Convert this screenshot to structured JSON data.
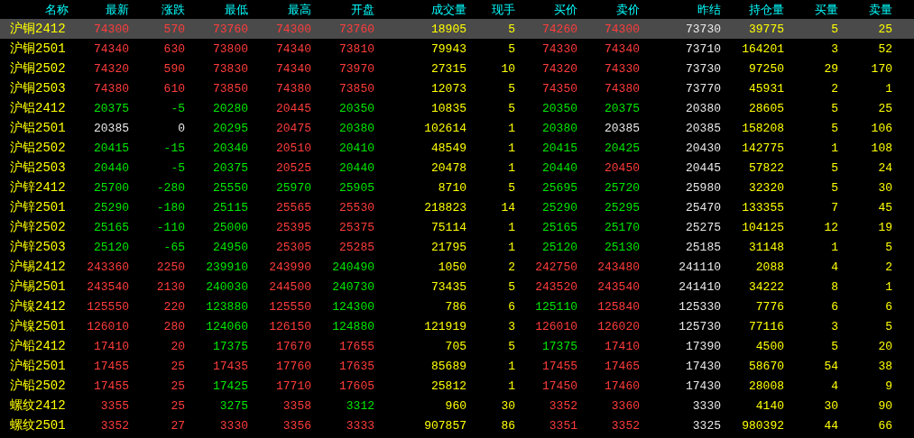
{
  "table": {
    "columns": [
      {
        "label": "名称",
        "kind": "name"
      },
      {
        "label": "最新",
        "kind": "price"
      },
      {
        "label": "涨跌",
        "kind": "price"
      },
      {
        "label": "最低",
        "kind": "price"
      },
      {
        "label": "最高",
        "kind": "price"
      },
      {
        "label": "开盘",
        "kind": "price"
      },
      {
        "label": "成交量",
        "kind": "volume"
      },
      {
        "label": "现手",
        "kind": "volume"
      },
      {
        "label": "买价",
        "kind": "price"
      },
      {
        "label": "卖价",
        "kind": "price"
      },
      {
        "label": "昨结",
        "kind": "ref"
      },
      {
        "label": "持仓量",
        "kind": "volume"
      },
      {
        "label": "买量",
        "kind": "volume"
      },
      {
        "label": "卖量",
        "kind": "volume"
      }
    ],
    "rows": [
      {
        "selected": true,
        "cells": [
          {
            "text": "沪铜2412"
          },
          {
            "text": "74300",
            "color": "#ff3c3c"
          },
          {
            "text": "570",
            "color": "#ff3c3c"
          },
          {
            "text": "73760",
            "color": "#ff3c3c"
          },
          {
            "text": "74300",
            "color": "#ff3c3c"
          },
          {
            "text": "73760",
            "color": "#ff3c3c"
          },
          {
            "text": "18905"
          },
          {
            "text": "5"
          },
          {
            "text": "74260",
            "color": "#ff3c3c"
          },
          {
            "text": "74300",
            "color": "#ff3c3c"
          },
          {
            "text": "73730"
          },
          {
            "text": "39775"
          },
          {
            "text": "5"
          },
          {
            "text": "25"
          }
        ]
      },
      {
        "selected": false,
        "cells": [
          {
            "text": "沪铜2501"
          },
          {
            "text": "74340",
            "color": "#ff3c3c"
          },
          {
            "text": "630",
            "color": "#ff3c3c"
          },
          {
            "text": "73800",
            "color": "#ff3c3c"
          },
          {
            "text": "74340",
            "color": "#ff3c3c"
          },
          {
            "text": "73810",
            "color": "#ff3c3c"
          },
          {
            "text": "79943"
          },
          {
            "text": "5"
          },
          {
            "text": "74330",
            "color": "#ff3c3c"
          },
          {
            "text": "74340",
            "color": "#ff3c3c"
          },
          {
            "text": "73710"
          },
          {
            "text": "164201"
          },
          {
            "text": "3"
          },
          {
            "text": "52"
          }
        ]
      },
      {
        "selected": false,
        "cells": [
          {
            "text": "沪铜2502"
          },
          {
            "text": "74320",
            "color": "#ff3c3c"
          },
          {
            "text": "590",
            "color": "#ff3c3c"
          },
          {
            "text": "73830",
            "color": "#ff3c3c"
          },
          {
            "text": "74340",
            "color": "#ff3c3c"
          },
          {
            "text": "73970",
            "color": "#ff3c3c"
          },
          {
            "text": "27315"
          },
          {
            "text": "10"
          },
          {
            "text": "74320",
            "color": "#ff3c3c"
          },
          {
            "text": "74330",
            "color": "#ff3c3c"
          },
          {
            "text": "73730"
          },
          {
            "text": "97250"
          },
          {
            "text": "29"
          },
          {
            "text": "170"
          }
        ]
      },
      {
        "selected": false,
        "cells": [
          {
            "text": "沪铜2503"
          },
          {
            "text": "74380",
            "color": "#ff3c3c"
          },
          {
            "text": "610",
            "color": "#ff3c3c"
          },
          {
            "text": "73850",
            "color": "#ff3c3c"
          },
          {
            "text": "74380",
            "color": "#ff3c3c"
          },
          {
            "text": "73850",
            "color": "#ff3c3c"
          },
          {
            "text": "12073"
          },
          {
            "text": "5"
          },
          {
            "text": "74350",
            "color": "#ff3c3c"
          },
          {
            "text": "74380",
            "color": "#ff3c3c"
          },
          {
            "text": "73770"
          },
          {
            "text": "45931"
          },
          {
            "text": "2"
          },
          {
            "text": "1"
          }
        ]
      },
      {
        "selected": false,
        "cells": [
          {
            "text": "沪铝2412"
          },
          {
            "text": "20375",
            "color": "#00e800"
          },
          {
            "text": "-5",
            "color": "#00e800"
          },
          {
            "text": "20280",
            "color": "#00e800"
          },
          {
            "text": "20445",
            "color": "#ff3c3c"
          },
          {
            "text": "20350",
            "color": "#00e800"
          },
          {
            "text": "10835"
          },
          {
            "text": "5"
          },
          {
            "text": "20350",
            "color": "#00e800"
          },
          {
            "text": "20375",
            "color": "#00e800"
          },
          {
            "text": "20380"
          },
          {
            "text": "28605"
          },
          {
            "text": "5"
          },
          {
            "text": "25"
          }
        ]
      },
      {
        "selected": false,
        "cells": [
          {
            "text": "沪铝2501"
          },
          {
            "text": "20385",
            "color": "#e8e8e8"
          },
          {
            "text": "0",
            "color": "#e8e8e8"
          },
          {
            "text": "20295",
            "color": "#00e800"
          },
          {
            "text": "20475",
            "color": "#ff3c3c"
          },
          {
            "text": "20380",
            "color": "#00e800"
          },
          {
            "text": "102614"
          },
          {
            "text": "1"
          },
          {
            "text": "20380",
            "color": "#00e800"
          },
          {
            "text": "20385",
            "color": "#e8e8e8"
          },
          {
            "text": "20385"
          },
          {
            "text": "158208"
          },
          {
            "text": "5"
          },
          {
            "text": "106"
          }
        ]
      },
      {
        "selected": false,
        "cells": [
          {
            "text": "沪铝2502"
          },
          {
            "text": "20415",
            "color": "#00e800"
          },
          {
            "text": "-15",
            "color": "#00e800"
          },
          {
            "text": "20340",
            "color": "#00e800"
          },
          {
            "text": "20510",
            "color": "#ff3c3c"
          },
          {
            "text": "20410",
            "color": "#00e800"
          },
          {
            "text": "48549"
          },
          {
            "text": "1"
          },
          {
            "text": "20415",
            "color": "#00e800"
          },
          {
            "text": "20425",
            "color": "#00e800"
          },
          {
            "text": "20430"
          },
          {
            "text": "142775"
          },
          {
            "text": "1"
          },
          {
            "text": "108"
          }
        ]
      },
      {
        "selected": false,
        "cells": [
          {
            "text": "沪铝2503"
          },
          {
            "text": "20440",
            "color": "#00e800"
          },
          {
            "text": "-5",
            "color": "#00e800"
          },
          {
            "text": "20375",
            "color": "#00e800"
          },
          {
            "text": "20525",
            "color": "#ff3c3c"
          },
          {
            "text": "20440",
            "color": "#00e800"
          },
          {
            "text": "20478"
          },
          {
            "text": "1"
          },
          {
            "text": "20440",
            "color": "#00e800"
          },
          {
            "text": "20450",
            "color": "#ff3c3c"
          },
          {
            "text": "20445"
          },
          {
            "text": "57822"
          },
          {
            "text": "5"
          },
          {
            "text": "24"
          }
        ]
      },
      {
        "selected": false,
        "cells": [
          {
            "text": "沪锌2412"
          },
          {
            "text": "25700",
            "color": "#00e800"
          },
          {
            "text": "-280",
            "color": "#00e800"
          },
          {
            "text": "25550",
            "color": "#00e800"
          },
          {
            "text": "25970",
            "color": "#00e800"
          },
          {
            "text": "25905",
            "color": "#00e800"
          },
          {
            "text": "8710"
          },
          {
            "text": "5"
          },
          {
            "text": "25695",
            "color": "#00e800"
          },
          {
            "text": "25720",
            "color": "#00e800"
          },
          {
            "text": "25980"
          },
          {
            "text": "32320"
          },
          {
            "text": "5"
          },
          {
            "text": "30"
          }
        ]
      },
      {
        "selected": false,
        "cells": [
          {
            "text": "沪锌2501"
          },
          {
            "text": "25290",
            "color": "#00e800"
          },
          {
            "text": "-180",
            "color": "#00e800"
          },
          {
            "text": "25115",
            "color": "#00e800"
          },
          {
            "text": "25565",
            "color": "#ff3c3c"
          },
          {
            "text": "25530",
            "color": "#ff3c3c"
          },
          {
            "text": "218823"
          },
          {
            "text": "14"
          },
          {
            "text": "25290",
            "color": "#00e800"
          },
          {
            "text": "25295",
            "color": "#00e800"
          },
          {
            "text": "25470"
          },
          {
            "text": "133355"
          },
          {
            "text": "7"
          },
          {
            "text": "45"
          }
        ]
      },
      {
        "selected": false,
        "cells": [
          {
            "text": "沪锌2502"
          },
          {
            "text": "25165",
            "color": "#00e800"
          },
          {
            "text": "-110",
            "color": "#00e800"
          },
          {
            "text": "25000",
            "color": "#00e800"
          },
          {
            "text": "25395",
            "color": "#ff3c3c"
          },
          {
            "text": "25375",
            "color": "#ff3c3c"
          },
          {
            "text": "75114"
          },
          {
            "text": "1"
          },
          {
            "text": "25165",
            "color": "#00e800"
          },
          {
            "text": "25170",
            "color": "#00e800"
          },
          {
            "text": "25275"
          },
          {
            "text": "104125"
          },
          {
            "text": "12"
          },
          {
            "text": "19"
          }
        ]
      },
      {
        "selected": false,
        "cells": [
          {
            "text": "沪锌2503"
          },
          {
            "text": "25120",
            "color": "#00e800"
          },
          {
            "text": "-65",
            "color": "#00e800"
          },
          {
            "text": "24950",
            "color": "#00e800"
          },
          {
            "text": "25305",
            "color": "#ff3c3c"
          },
          {
            "text": "25285",
            "color": "#ff3c3c"
          },
          {
            "text": "21795"
          },
          {
            "text": "1"
          },
          {
            "text": "25120",
            "color": "#00e800"
          },
          {
            "text": "25130",
            "color": "#00e800"
          },
          {
            "text": "25185"
          },
          {
            "text": "31148"
          },
          {
            "text": "1"
          },
          {
            "text": "5"
          }
        ]
      },
      {
        "selected": false,
        "cells": [
          {
            "text": "沪锡2412"
          },
          {
            "text": "243360",
            "color": "#ff3c3c"
          },
          {
            "text": "2250",
            "color": "#ff3c3c"
          },
          {
            "text": "239910",
            "color": "#00e800"
          },
          {
            "text": "243990",
            "color": "#ff3c3c"
          },
          {
            "text": "240490",
            "color": "#00e800"
          },
          {
            "text": "1050"
          },
          {
            "text": "2"
          },
          {
            "text": "242750",
            "color": "#ff3c3c"
          },
          {
            "text": "243480",
            "color": "#ff3c3c"
          },
          {
            "text": "241110"
          },
          {
            "text": "2088"
          },
          {
            "text": "4"
          },
          {
            "text": "2"
          }
        ]
      },
      {
        "selected": false,
        "cells": [
          {
            "text": "沪锡2501"
          },
          {
            "text": "243540",
            "color": "#ff3c3c"
          },
          {
            "text": "2130",
            "color": "#ff3c3c"
          },
          {
            "text": "240030",
            "color": "#00e800"
          },
          {
            "text": "244500",
            "color": "#ff3c3c"
          },
          {
            "text": "240730",
            "color": "#00e800"
          },
          {
            "text": "73435"
          },
          {
            "text": "5"
          },
          {
            "text": "243520",
            "color": "#ff3c3c"
          },
          {
            "text": "243540",
            "color": "#ff3c3c"
          },
          {
            "text": "241410"
          },
          {
            "text": "34222"
          },
          {
            "text": "8"
          },
          {
            "text": "1"
          }
        ]
      },
      {
        "selected": false,
        "cells": [
          {
            "text": "沪镍2412"
          },
          {
            "text": "125550",
            "color": "#ff3c3c"
          },
          {
            "text": "220",
            "color": "#ff3c3c"
          },
          {
            "text": "123880",
            "color": "#00e800"
          },
          {
            "text": "125550",
            "color": "#ff3c3c"
          },
          {
            "text": "124300",
            "color": "#00e800"
          },
          {
            "text": "786"
          },
          {
            "text": "6"
          },
          {
            "text": "125110",
            "color": "#00e800"
          },
          {
            "text": "125840",
            "color": "#ff3c3c"
          },
          {
            "text": "125330"
          },
          {
            "text": "7776"
          },
          {
            "text": "6"
          },
          {
            "text": "6"
          }
        ]
      },
      {
        "selected": false,
        "cells": [
          {
            "text": "沪镍2501"
          },
          {
            "text": "126010",
            "color": "#ff3c3c"
          },
          {
            "text": "280",
            "color": "#ff3c3c"
          },
          {
            "text": "124060",
            "color": "#00e800"
          },
          {
            "text": "126150",
            "color": "#ff3c3c"
          },
          {
            "text": "124880",
            "color": "#00e800"
          },
          {
            "text": "121919"
          },
          {
            "text": "3"
          },
          {
            "text": "126010",
            "color": "#ff3c3c"
          },
          {
            "text": "126020",
            "color": "#ff3c3c"
          },
          {
            "text": "125730"
          },
          {
            "text": "77116"
          },
          {
            "text": "3"
          },
          {
            "text": "5"
          }
        ]
      },
      {
        "selected": false,
        "cells": [
          {
            "text": "沪铅2412"
          },
          {
            "text": "17410",
            "color": "#ff3c3c"
          },
          {
            "text": "20",
            "color": "#ff3c3c"
          },
          {
            "text": "17375",
            "color": "#00e800"
          },
          {
            "text": "17670",
            "color": "#ff3c3c"
          },
          {
            "text": "17655",
            "color": "#ff3c3c"
          },
          {
            "text": "705"
          },
          {
            "text": "5"
          },
          {
            "text": "17375",
            "color": "#00e800"
          },
          {
            "text": "17410",
            "color": "#ff3c3c"
          },
          {
            "text": "17390"
          },
          {
            "text": "4500"
          },
          {
            "text": "5"
          },
          {
            "text": "20"
          }
        ]
      },
      {
        "selected": false,
        "cells": [
          {
            "text": "沪铅2501"
          },
          {
            "text": "17455",
            "color": "#ff3c3c"
          },
          {
            "text": "25",
            "color": "#ff3c3c"
          },
          {
            "text": "17435",
            "color": "#ff3c3c"
          },
          {
            "text": "17760",
            "color": "#ff3c3c"
          },
          {
            "text": "17635",
            "color": "#ff3c3c"
          },
          {
            "text": "85689"
          },
          {
            "text": "1"
          },
          {
            "text": "17455",
            "color": "#ff3c3c"
          },
          {
            "text": "17465",
            "color": "#ff3c3c"
          },
          {
            "text": "17430"
          },
          {
            "text": "58670"
          },
          {
            "text": "54"
          },
          {
            "text": "38"
          }
        ]
      },
      {
        "selected": false,
        "cells": [
          {
            "text": "沪铅2502"
          },
          {
            "text": "17455",
            "color": "#ff3c3c"
          },
          {
            "text": "25",
            "color": "#ff3c3c"
          },
          {
            "text": "17425",
            "color": "#00e800"
          },
          {
            "text": "17710",
            "color": "#ff3c3c"
          },
          {
            "text": "17605",
            "color": "#ff3c3c"
          },
          {
            "text": "25812"
          },
          {
            "text": "1"
          },
          {
            "text": "17450",
            "color": "#ff3c3c"
          },
          {
            "text": "17460",
            "color": "#ff3c3c"
          },
          {
            "text": "17430"
          },
          {
            "text": "28008"
          },
          {
            "text": "4"
          },
          {
            "text": "9"
          }
        ]
      },
      {
        "selected": false,
        "cells": [
          {
            "text": "螺纹2412"
          },
          {
            "text": "3355",
            "color": "#ff3c3c"
          },
          {
            "text": "25",
            "color": "#ff3c3c"
          },
          {
            "text": "3275",
            "color": "#00e800"
          },
          {
            "text": "3358",
            "color": "#ff3c3c"
          },
          {
            "text": "3312",
            "color": "#00e800"
          },
          {
            "text": "960"
          },
          {
            "text": "30"
          },
          {
            "text": "3352",
            "color": "#ff3c3c"
          },
          {
            "text": "3360",
            "color": "#ff3c3c"
          },
          {
            "text": "3330"
          },
          {
            "text": "4140"
          },
          {
            "text": "30"
          },
          {
            "text": "90"
          }
        ]
      },
      {
        "selected": false,
        "cells": [
          {
            "text": "螺纹2501"
          },
          {
            "text": "3352",
            "color": "#ff3c3c"
          },
          {
            "text": "27",
            "color": "#ff3c3c"
          },
          {
            "text": "3330",
            "color": "#ff3c3c"
          },
          {
            "text": "3356",
            "color": "#ff3c3c"
          },
          {
            "text": "3333",
            "color": "#ff3c3c"
          },
          {
            "text": "907857"
          },
          {
            "text": "86"
          },
          {
            "text": "3351",
            "color": "#ff3c3c"
          },
          {
            "text": "3352",
            "color": "#ff3c3c"
          },
          {
            "text": "3325"
          },
          {
            "text": "980392"
          },
          {
            "text": "44"
          },
          {
            "text": "66"
          }
        ]
      }
    ]
  }
}
